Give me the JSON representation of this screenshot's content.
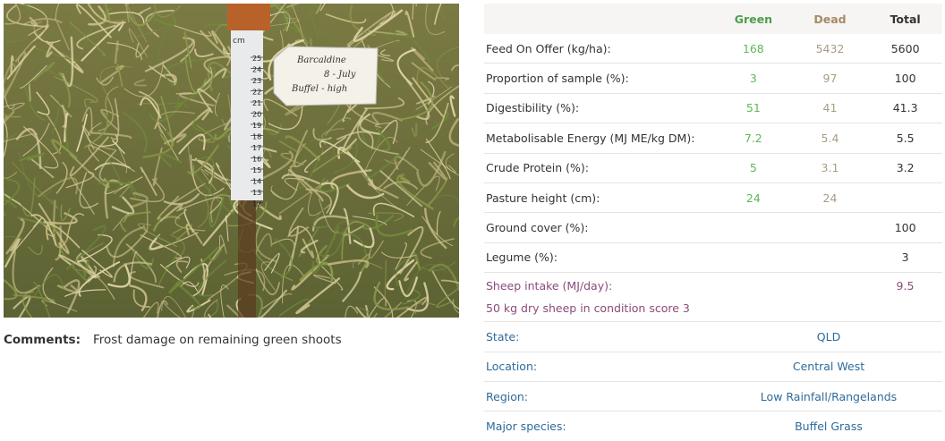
{
  "photo": {
    "alt": "pasture-photo",
    "ruler_unit": "cm",
    "ruler_ticks": [
      "25",
      "24",
      "23",
      "22",
      "21",
      "20",
      "19",
      "18",
      "17",
      "16",
      "15",
      "14",
      "13",
      "12"
    ],
    "tag_lines": [
      "Barcaldine",
      "8 - July",
      "Buffel - high"
    ]
  },
  "comments": {
    "label": "Comments:",
    "text": "Frost damage on remaining green shoots"
  },
  "table": {
    "headers": {
      "green": "Green",
      "dead": "Dead",
      "total": "Total"
    },
    "rows": [
      {
        "label": "Feed On Offer (kg/ha):",
        "green": "168",
        "dead": "5432",
        "total": "5600"
      },
      {
        "label": "Proportion of sample (%):",
        "green": "3",
        "dead": "97",
        "total": "100"
      },
      {
        "label": "Digestibility (%):",
        "green": "51",
        "dead": "41",
        "total": "41.3"
      },
      {
        "label": "Metabolisable Energy (MJ ME/kg DM):",
        "green": "7.2",
        "dead": "5.4",
        "total": "5.5"
      },
      {
        "label": "Crude Protein (%):",
        "green": "5",
        "dead": "3.1",
        "total": "3.2"
      },
      {
        "label": "Pasture height (cm):",
        "green": "24",
        "dead": "24",
        "total": ""
      },
      {
        "label": "Ground cover (%):",
        "green": "",
        "dead": "",
        "total": "100"
      },
      {
        "label": "Legume (%):",
        "green": "",
        "dead": "",
        "total": "3"
      }
    ],
    "sheep": {
      "label": "Sheep intake (MJ/day):",
      "note": "50 kg dry sheep in condition score 3",
      "value": "9.5"
    },
    "info": [
      {
        "label": "State:",
        "value": "QLD"
      },
      {
        "label": "Location:",
        "value": "Central West"
      },
      {
        "label": "Region:",
        "value": "Low Rainfall/Rangelands"
      },
      {
        "label": "Major species:",
        "value": "Buffel Grass"
      }
    ]
  }
}
